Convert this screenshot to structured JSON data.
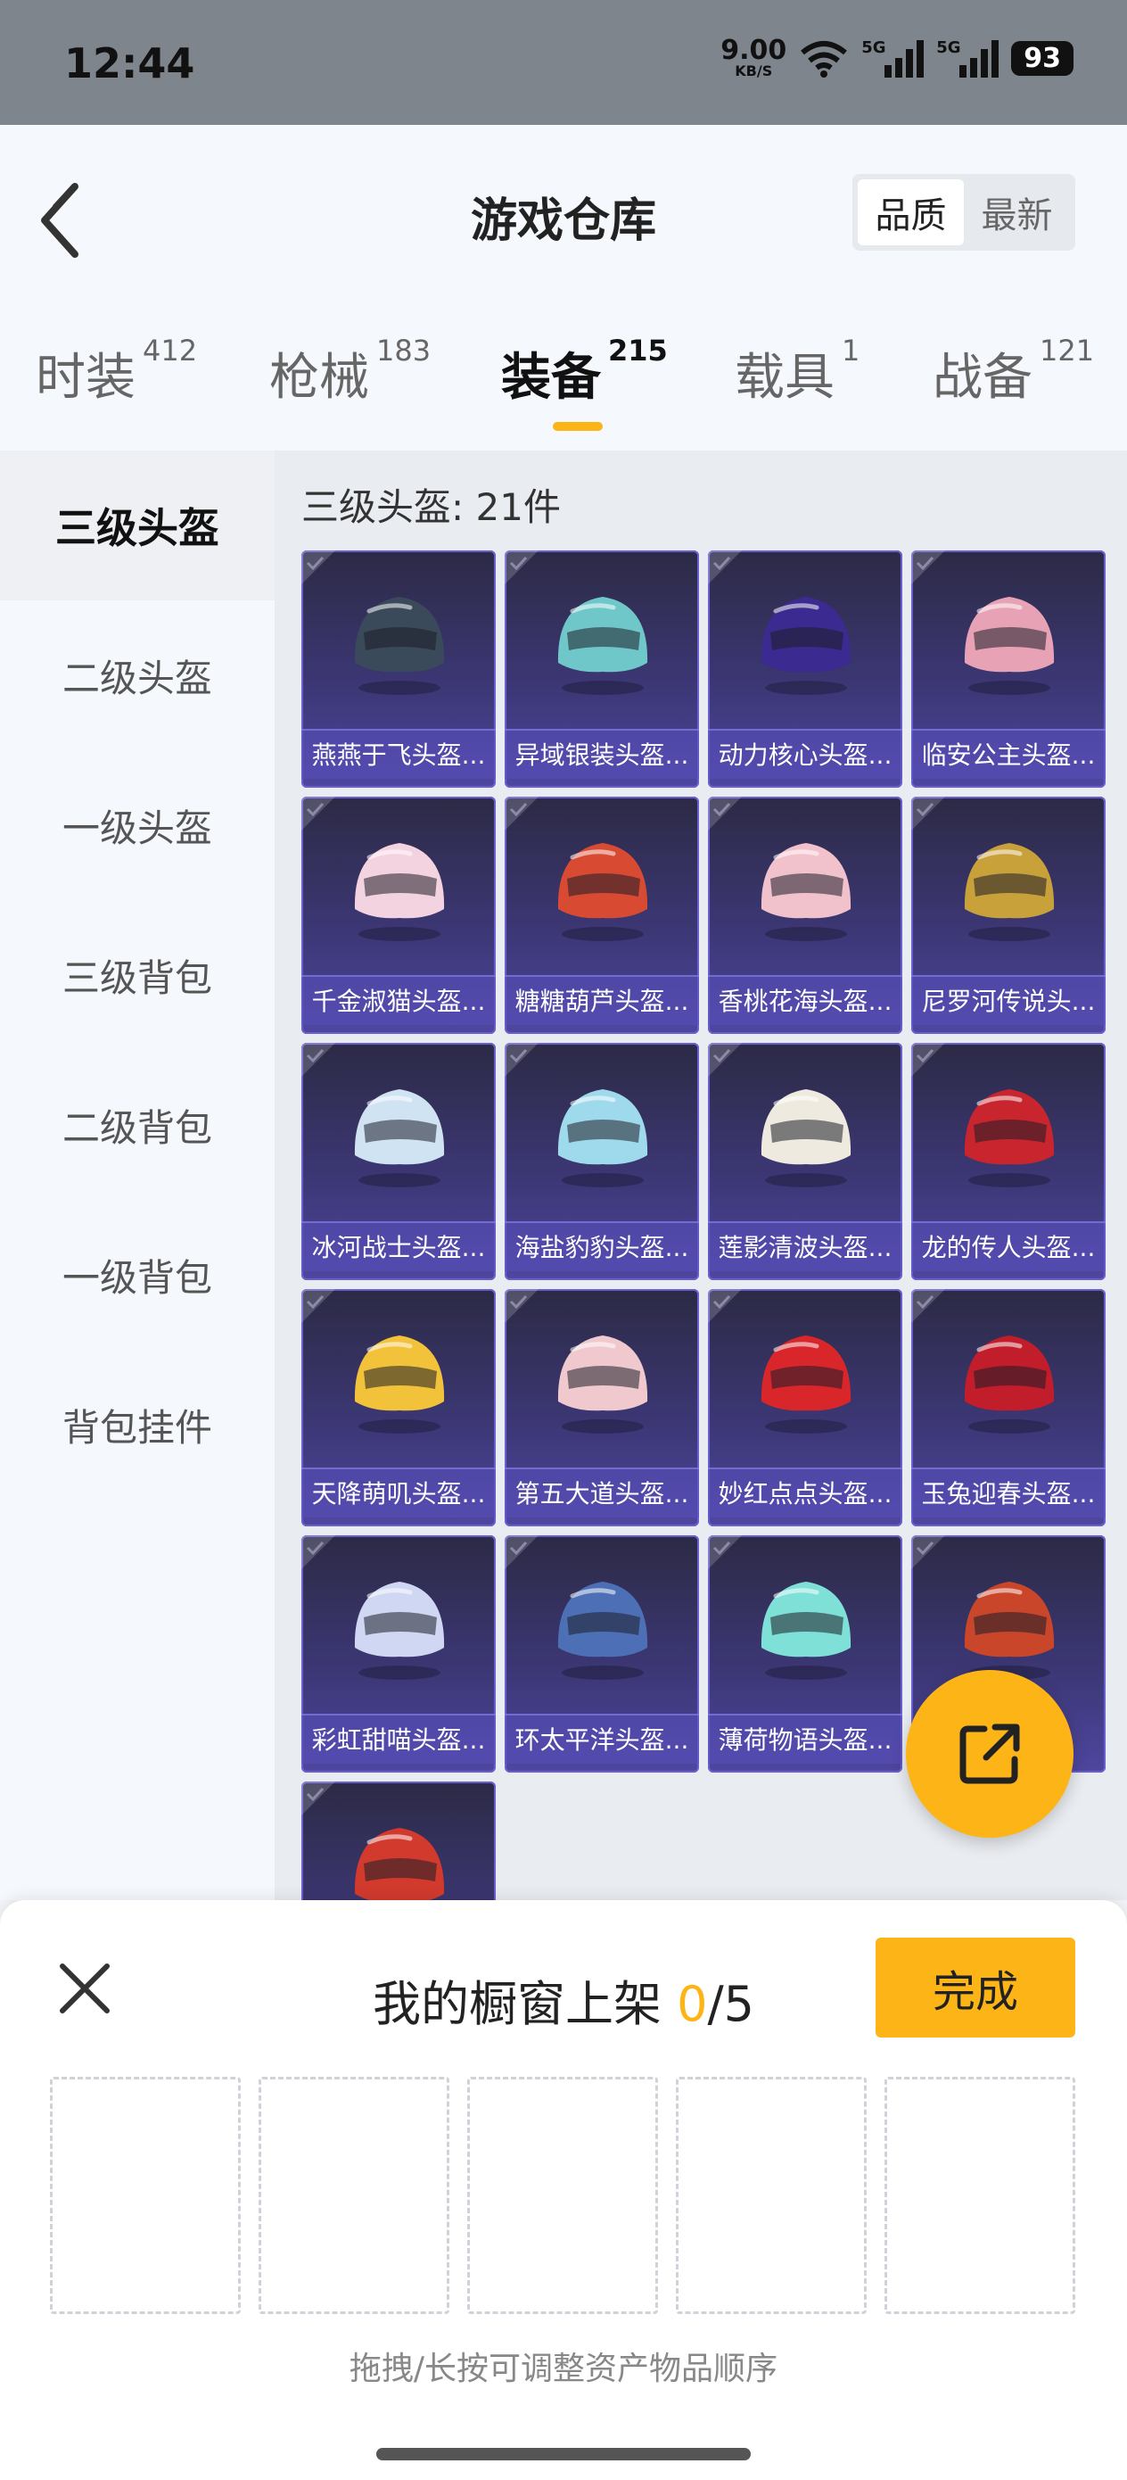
{
  "status_bar": {
    "time": "12:44",
    "speed_value": "9.00",
    "speed_unit": "KB/S",
    "signal_label": "5G",
    "battery": "93"
  },
  "header": {
    "title": "游戏仓库",
    "sort_options": [
      "品质",
      "最新"
    ],
    "active_sort": "品质"
  },
  "tabs": [
    {
      "label": "时装",
      "count": "412"
    },
    {
      "label": "枪械",
      "count": "183"
    },
    {
      "label": "装备",
      "count": "215"
    },
    {
      "label": "载具",
      "count": "1"
    },
    {
      "label": "战备",
      "count": "121"
    }
  ],
  "active_tab": "装备",
  "sidebar": {
    "items": [
      "三级头盔",
      "二级头盔",
      "一级头盔",
      "三级背包",
      "二级背包",
      "一级背包",
      "背包挂件"
    ],
    "active": "三级头盔"
  },
  "section": {
    "title": "三级头盔: 21件"
  },
  "items": [
    {
      "name": "燕燕于飞头盔...",
      "color": "#3a4a5a"
    },
    {
      "name": "异域银装头盔...",
      "color": "#6fc7c9"
    },
    {
      "name": "动力核心头盔...",
      "color": "#3b2a8f"
    },
    {
      "name": "临安公主头盔...",
      "color": "#e7a3b5"
    },
    {
      "name": "千金淑猫头盔...",
      "color": "#f3d3e0"
    },
    {
      "name": "糖糖葫芦头盔...",
      "color": "#d94a32"
    },
    {
      "name": "香桃花海头盔...",
      "color": "#f2c2cc"
    },
    {
      "name": "尼罗河传说头...",
      "color": "#c9a13a"
    },
    {
      "name": "冰河战士头盔...",
      "color": "#cfe3f3"
    },
    {
      "name": "海盐豹豹头盔...",
      "color": "#9fd9ec"
    },
    {
      "name": "莲影清波头盔...",
      "color": "#eeeadf"
    },
    {
      "name": "龙的传人头盔...",
      "color": "#c9252e"
    },
    {
      "name": "天降萌叽头盔...",
      "color": "#f2c33a"
    },
    {
      "name": "第五大道头盔...",
      "color": "#f0c9cf"
    },
    {
      "name": "妙红点点头盔...",
      "color": "#d8262b"
    },
    {
      "name": "玉兔迎春头盔...",
      "color": "#c21d2b"
    },
    {
      "name": "彩虹甜喵头盔...",
      "color": "#cfd7f3"
    },
    {
      "name": "环太平洋头盔...",
      "color": "#4c6fb6"
    },
    {
      "name": "薄荷物语头盔...",
      "color": "#7fe0d8"
    },
    {
      "name": "",
      "color": "#c9462a"
    },
    {
      "name": "",
      "color": "#d23a2e"
    }
  ],
  "bottom_sheet": {
    "title_prefix": "我的橱窗上架 ",
    "current": "0",
    "total_suffix": "/5",
    "done_label": "完成",
    "hint": "拖拽/长按可调整资产物品顺序",
    "slot_count": 5
  }
}
